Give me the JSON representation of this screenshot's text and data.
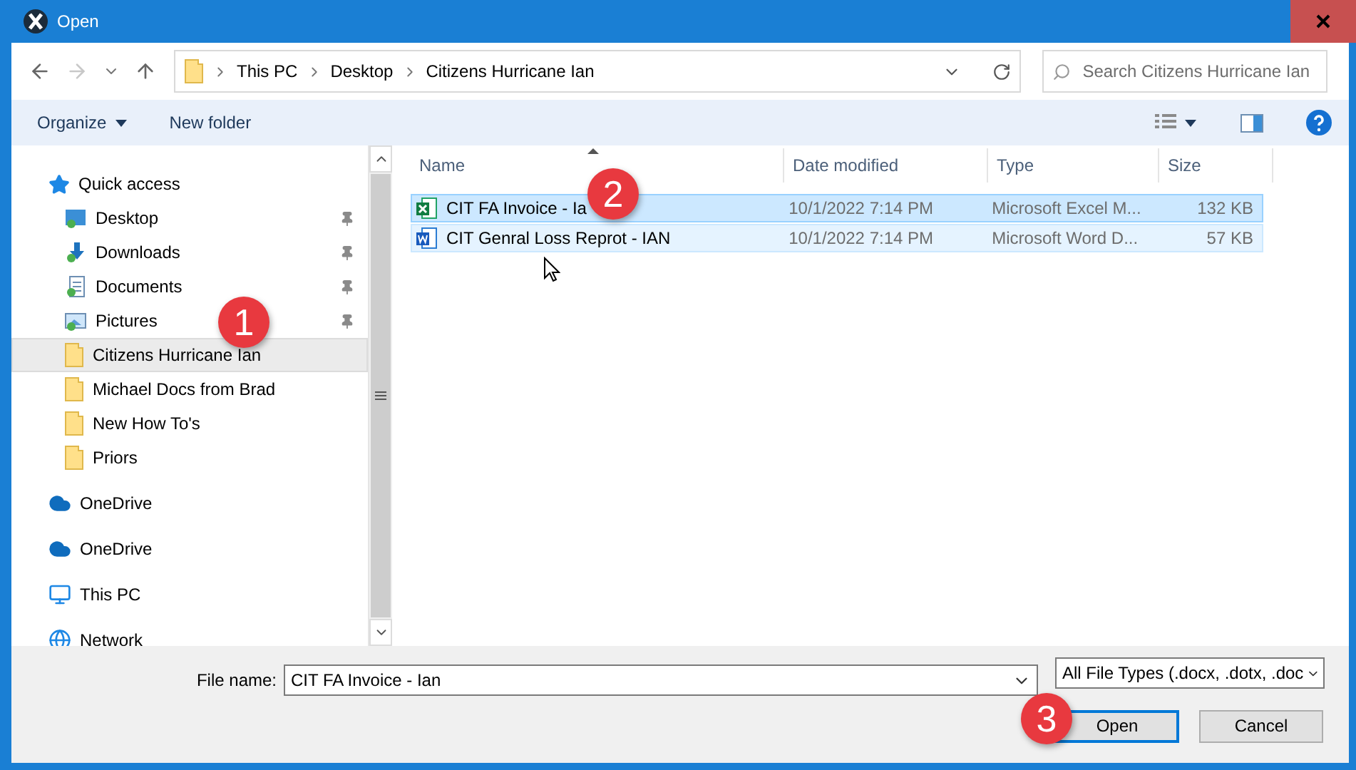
{
  "window": {
    "title": "Open"
  },
  "address": {
    "crumbs": [
      "This PC",
      "Desktop",
      "Citizens Hurricane Ian"
    ]
  },
  "search": {
    "placeholder": "Search Citizens Hurricane Ian"
  },
  "toolbar": {
    "buttons": [
      "Organize",
      "New folder"
    ]
  },
  "nav": {
    "items": [
      {
        "label": "Quick access",
        "kind": "star",
        "selected": false,
        "children": [
          {
            "label": "Desktop",
            "kind": "desktop",
            "pinned": true,
            "selected": false
          },
          {
            "label": "Downloads",
            "kind": "downloads",
            "pinned": true,
            "selected": false
          },
          {
            "label": "Documents",
            "kind": "documents",
            "pinned": true,
            "selected": false
          },
          {
            "label": "Pictures",
            "kind": "pictures",
            "pinned": true,
            "selected": false
          },
          {
            "label": "Citizens Hurricane Ian",
            "kind": "folder",
            "pinned": false,
            "selected": true
          },
          {
            "label": "Michael Docs from Brad",
            "kind": "folder",
            "pinned": false,
            "selected": false
          },
          {
            "label": "New How To's",
            "kind": "folder",
            "pinned": false,
            "selected": false
          },
          {
            "label": "Priors",
            "kind": "folder",
            "pinned": false,
            "selected": false
          }
        ]
      },
      {
        "label": "OneDrive",
        "kind": "cloud",
        "selected": false
      },
      {
        "label": "OneDrive",
        "kind": "cloud",
        "selected": false
      },
      {
        "label": "This PC",
        "kind": "pc",
        "selected": false
      },
      {
        "label": "Network",
        "kind": "network",
        "selected": false
      }
    ]
  },
  "table": {
    "columns": [
      "Name",
      "Date modified",
      "Type",
      "Size"
    ],
    "rows": [
      {
        "kind": "excel",
        "selected": true,
        "cells": [
          "CIT FA Invoice - Ia",
          "10/1/2022 7:14 PM",
          "Microsoft Excel M...",
          "132 KB"
        ]
      },
      {
        "kind": "word",
        "selected": false,
        "cells": [
          "CIT Genral Loss Reprot - IAN",
          "10/1/2022 7:14 PM",
          "Microsoft Word D...",
          "57 KB"
        ]
      }
    ]
  },
  "footer": {
    "file_name_label": "File name:",
    "file_name": "CIT FA Invoice - Ian",
    "file_type": "All File Types (.docx, .dotx, .doc",
    "buttons": [
      {
        "label": "Open",
        "default": true
      },
      {
        "label": "Cancel",
        "default": false
      }
    ]
  },
  "annotations": [
    "1",
    "2",
    "3"
  ]
}
